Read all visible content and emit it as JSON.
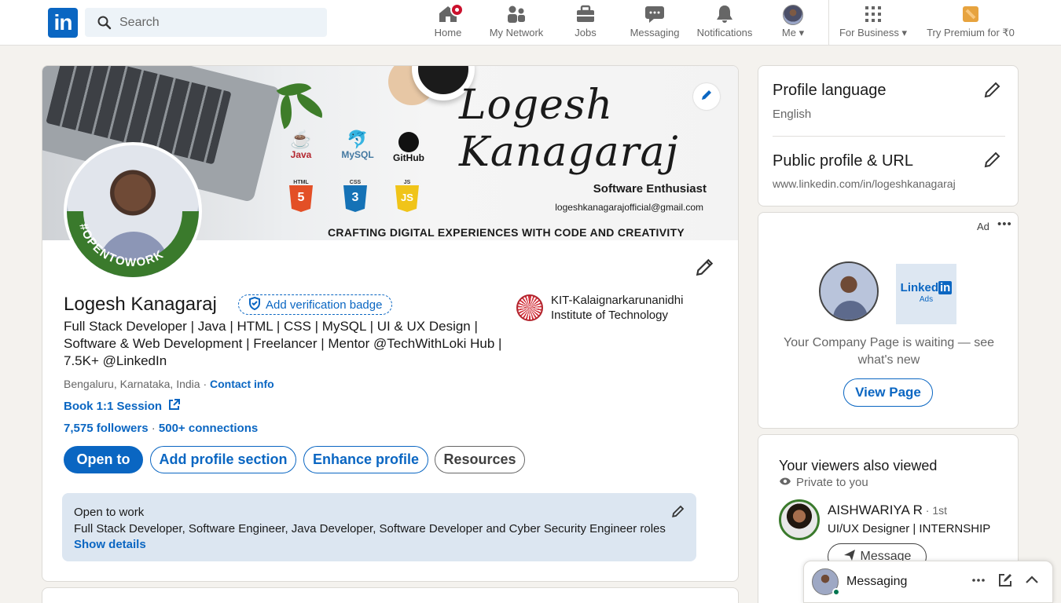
{
  "nav": {
    "search_placeholder": "Search",
    "items": [
      {
        "label": "Home",
        "icon": "home-icon"
      },
      {
        "label": "My Network",
        "icon": "people-icon"
      },
      {
        "label": "Jobs",
        "icon": "briefcase-icon"
      },
      {
        "label": "Messaging",
        "icon": "chat-icon"
      },
      {
        "label": "Notifications",
        "icon": "bell-icon"
      },
      {
        "label": "Me",
        "icon": "avatar"
      },
      {
        "label": "For Business",
        "icon": "grid-icon"
      },
      {
        "label": "Try Premium for ₹0",
        "icon": "premium-icon"
      }
    ]
  },
  "banner": {
    "signature": "Logesh Kanagaraj",
    "subtitle": "Software Enthusiast",
    "email": "logeshkanagarajofficial@gmail.com",
    "tagline": "CRAFTING DIGITAL EXPERIENCES WITH CODE AND CREATIVITY",
    "tech": [
      "Java",
      "MySQL",
      "GitHub",
      "HTML",
      "CSS",
      "JS"
    ],
    "tech_badges": [
      "5",
      "3",
      "JS"
    ]
  },
  "profile": {
    "name": "Logesh Kanagaraj",
    "verify_label": "Add verification badge",
    "headline": "Full Stack Developer | Java | HTML | CSS | MySQL | UI & UX Design | Software & Web Development | Freelancer | Mentor @TechWithLoki Hub | 7.5K+ @LinkedIn",
    "location": "Bengaluru, Karnataka, India ·",
    "contact_info": "Contact info",
    "book_session": "Book 1:1 Session",
    "followers": "7,575 followers",
    "connections_sep": " · ",
    "connections": "500+ connections",
    "school": "KIT-Kalaignarkarunanidhi Institute of Technology",
    "otw_ring_text": "#OPENTOWORK"
  },
  "actions": {
    "open_to": "Open to",
    "add_section": "Add profile section",
    "enhance": "Enhance profile",
    "resources": "Resources"
  },
  "open_to_work": {
    "title": "Open to work",
    "roles": "Full Stack Developer, Software Engineer, Java Developer, Software Developer and Cyber Security Engineer roles",
    "show_details": "Show details"
  },
  "sidebar": {
    "profile_language": {
      "title": "Profile language",
      "value": "English"
    },
    "public_profile": {
      "title": "Public profile & URL",
      "value": "www.linkedin.com/in/logeshkanagaraj"
    },
    "ad": {
      "label": "Ad",
      "more": "•••",
      "logo_text": "Linked",
      "logo_in": "in",
      "logo_sub": "Ads",
      "text": "Your Company Page is waiting — see what's new",
      "button": "View Page"
    },
    "viewers": {
      "title": "Your viewers also viewed",
      "privacy": "Private to you",
      "person": {
        "name": "AISHWARIYA R",
        "degree": " · 1st",
        "role": "UI/UX Designer | INTERNSHIP",
        "button": "Message"
      }
    }
  },
  "messaging": {
    "label": "Messaging"
  },
  "colors": {
    "brand": "#0a66c2",
    "background": "#f4f2ee",
    "open_to_work_green": "#3a7a2c",
    "notification_red": "#cb112d"
  }
}
